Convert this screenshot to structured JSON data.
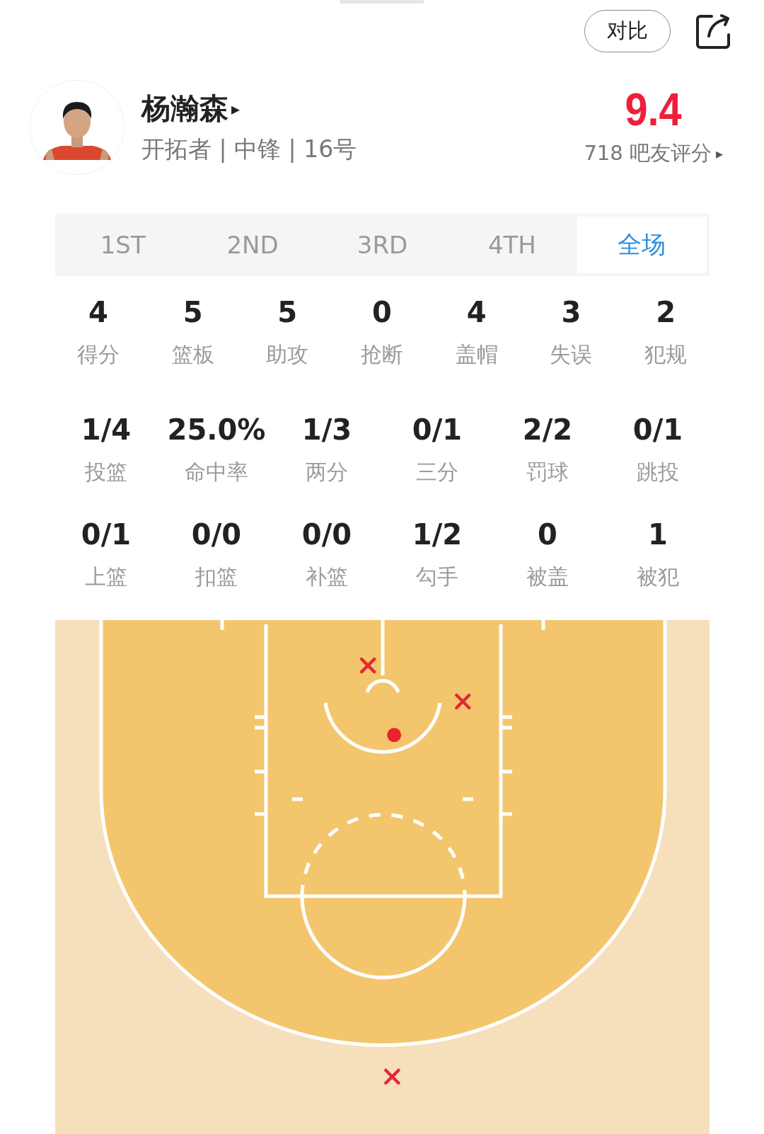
{
  "header": {
    "compare_button": "对比"
  },
  "player": {
    "name": "杨瀚森",
    "name_arrow": "▸",
    "info": "开拓者 | 中锋 | 16号",
    "rating": "9.4",
    "rating_count": "718 吧友评分",
    "rating_arrow": "▸"
  },
  "tabs": [
    {
      "label": "1ST",
      "selected": false
    },
    {
      "label": "2ND",
      "selected": false
    },
    {
      "label": "3RD",
      "selected": false
    },
    {
      "label": "4TH",
      "selected": false
    },
    {
      "label": "全场",
      "selected": true
    }
  ],
  "stat_rows": [
    {
      "stats": [
        {
          "value": "4",
          "label": "得分"
        },
        {
          "value": "5",
          "label": "篮板"
        },
        {
          "value": "5",
          "label": "助攻"
        },
        {
          "value": "0",
          "label": "抢断"
        },
        {
          "value": "4",
          "label": "盖帽"
        },
        {
          "value": "3",
          "label": "失误"
        },
        {
          "value": "2",
          "label": "犯规"
        }
      ]
    },
    {
      "stats": [
        {
          "value": "1/4",
          "label": "投篮"
        },
        {
          "value": "25.0%",
          "label": "命中率"
        },
        {
          "value": "1/3",
          "label": "两分"
        },
        {
          "value": "0/1",
          "label": "三分"
        },
        {
          "value": "2/2",
          "label": "罚球"
        },
        {
          "value": "0/1",
          "label": "跳投"
        }
      ]
    },
    {
      "stats": [
        {
          "value": "0/1",
          "label": "上篮"
        },
        {
          "value": "0/0",
          "label": "扣篮"
        },
        {
          "value": "0/0",
          "label": "补篮"
        },
        {
          "value": "1/2",
          "label": "勾手"
        },
        {
          "value": "0",
          "label": "被盖"
        },
        {
          "value": "1",
          "label": "被犯"
        }
      ]
    }
  ],
  "shot_chart": {
    "shots": [
      {
        "made": false
      },
      {
        "made": false
      },
      {
        "made": true
      },
      {
        "made": false
      }
    ]
  }
}
